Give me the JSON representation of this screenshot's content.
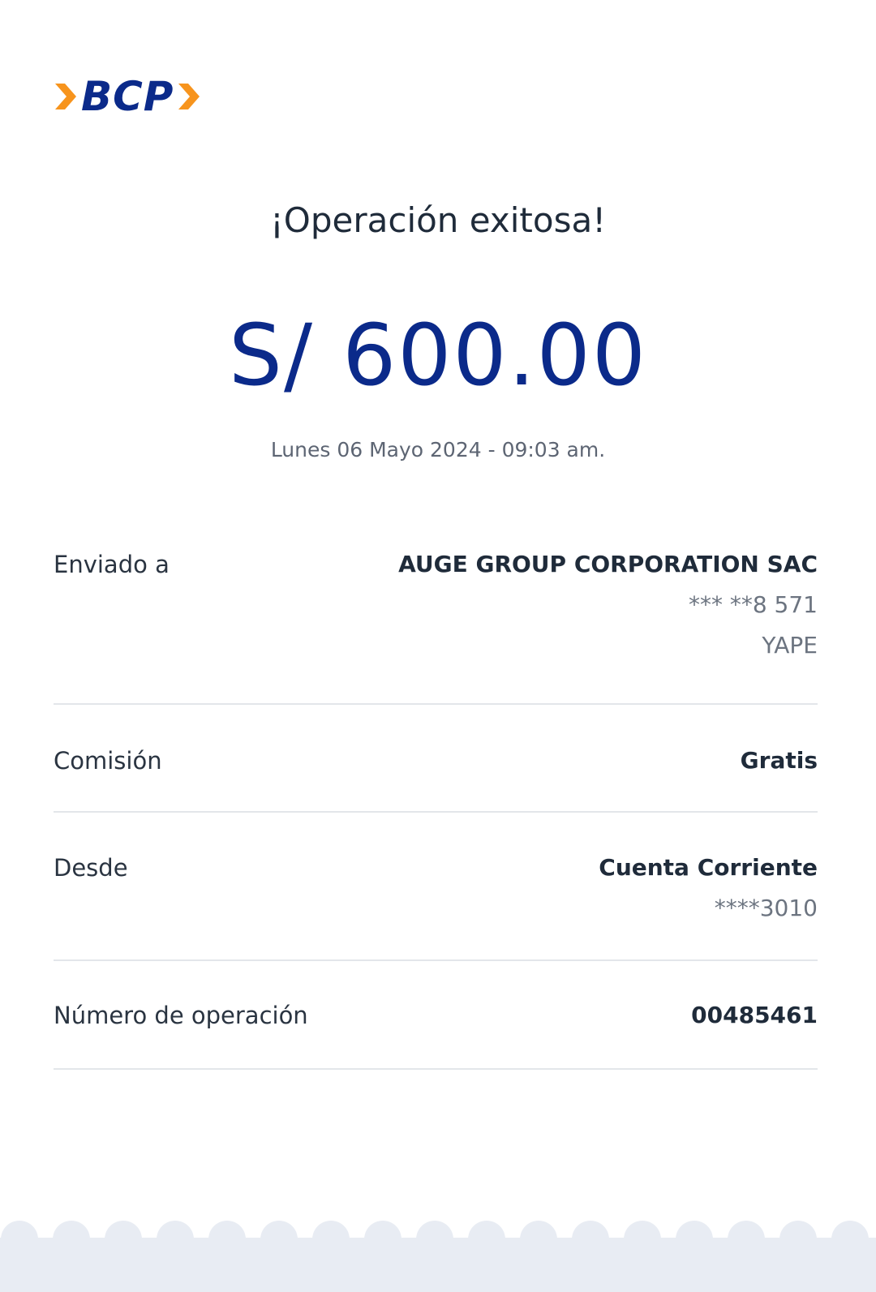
{
  "brand": {
    "logo_text": "BCP",
    "logo_color": "#0b2a8a",
    "accent_color": "#f7941d"
  },
  "receipt": {
    "title": "¡Operación exitosa!",
    "amount": "S/ 600.00",
    "datetime": "Lunes 06 Mayo 2024 - 09:03 am."
  },
  "details": {
    "sent_to": {
      "label": "Enviado a",
      "name": "AUGE GROUP CORPORATION SAC",
      "phone": "*** **8 571",
      "destination": "YAPE"
    },
    "commission": {
      "label": "Comisión",
      "value": "Gratis"
    },
    "from": {
      "label": "Desde",
      "account_type": "Cuenta Corriente",
      "account_number": "****3010"
    },
    "operation_number": {
      "label": "Número de operación",
      "value": "00485461"
    }
  }
}
